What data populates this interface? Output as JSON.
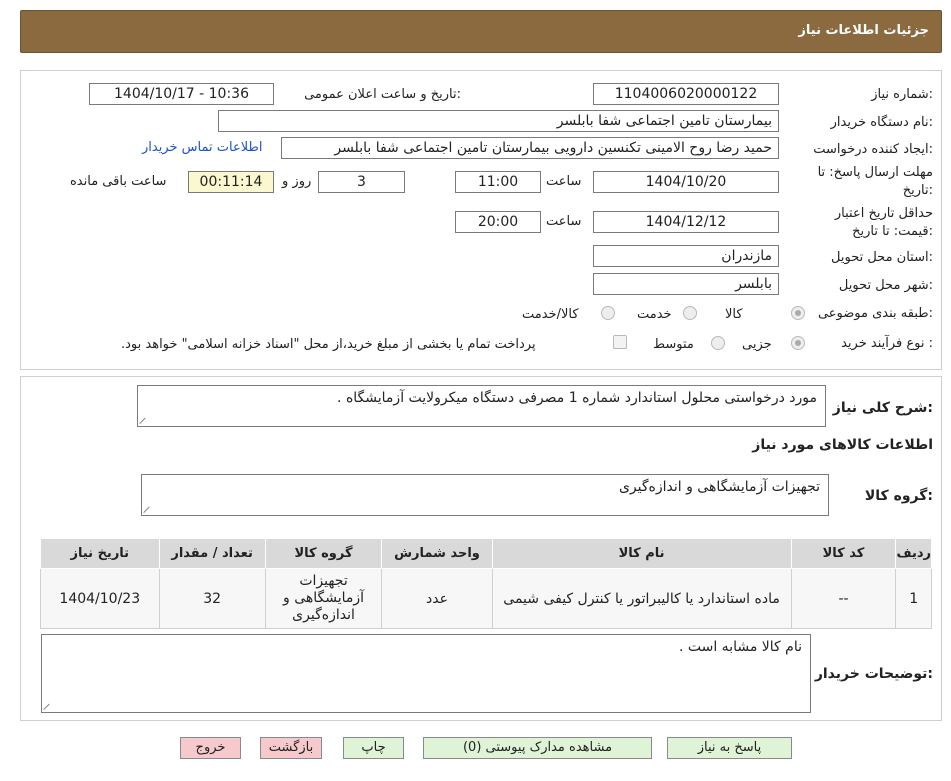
{
  "header": {
    "title": "جزئیات اطلاعات نیاز"
  },
  "fields": {
    "need_number_label": "شماره نیاز:",
    "need_number": "1104006020000122",
    "announce_label": "تاریخ و ساعت اعلان عمومی:",
    "announce_value": "1404/10/17 - 10:36",
    "buyer_org_label": "نام دستگاه خریدار:",
    "buyer_org": "بیمارستان تامین اجتماعی شفا بابلسر",
    "creator_label": "ایجاد کننده درخواست:",
    "creator": "حمید رضا روح الامینی تکنسین دارویی بیمارستان تامین اجتماعی شفا بابلسر",
    "contact_link": "اطلاعات تماس خریدار",
    "deadline_label_1": "مهلت ارسال پاسخ: تا",
    "deadline_label_2": "تاریخ:",
    "deadline_date": "1404/10/20",
    "time_label": "ساعت",
    "deadline_time": "11:00",
    "days_value": "3",
    "days_label": "روز و",
    "remaining_time": "00:11:14",
    "remaining_label": "ساعت باقی مانده",
    "validity_label_1": "حداقل تاریخ اعتبار",
    "validity_label_2": "قیمت: تا تاریخ:",
    "validity_date": "1404/12/12",
    "validity_time": "20:00",
    "province_label": "استان محل تحویل:",
    "province": "مازندران",
    "city_label": "شهر محل تحویل:",
    "city": "بابلسر",
    "category_label": "طبقه بندی موضوعی:",
    "category_options": [
      "کالا",
      "خدمت",
      "کالا/خدمت"
    ],
    "process_label": "نوع فرآیند خرید :",
    "process_options": [
      "جزیی",
      "متوسط"
    ],
    "payment_note": "پرداخت تمام یا بخشی از مبلغ خرید،از محل \"اسناد خزانه اسلامی\" خواهد بود."
  },
  "summary": {
    "label": "شرح کلی نیاز:",
    "text": "مورد درخواستی محلول استاندارد شماره 1 مصرفی دستگاه میکرولایت آزمایشگاه ."
  },
  "goods": {
    "section_title": "اطلاعات کالاهای مورد نیاز",
    "group_label": "گروه کالا:",
    "group_value": "تجهیزات آزمایشگاهی و اندازه‌گیری",
    "columns": [
      "ردیف",
      "کد کالا",
      "نام کالا",
      "واحد شمارش",
      "گروه کالا",
      "تعداد / مقدار",
      "تاریخ نیاز"
    ],
    "rows": [
      [
        "1",
        "--",
        "ماده استاندارد یا کالیبراتور یا کنترل کیفی شیمی",
        "عدد",
        "تجهیزات آزمایشگاهی و اندازه‌گیری",
        "32",
        "1404/10/23"
      ]
    ]
  },
  "buyer_notes": {
    "label": "توضیحات خریدار:",
    "text": "نام کالا مشابه است ."
  },
  "buttons": {
    "reply": "پاسخ به نیاز",
    "attachments": "مشاهده مدارک پیوستی (0)",
    "print": "چاپ",
    "back": "بازگشت",
    "exit": "خروج"
  },
  "colors": {
    "header": "#8b6a3f",
    "green_button": "#dff3d6",
    "pink_button": "#f6c9cc",
    "link": "#1a55c9"
  }
}
